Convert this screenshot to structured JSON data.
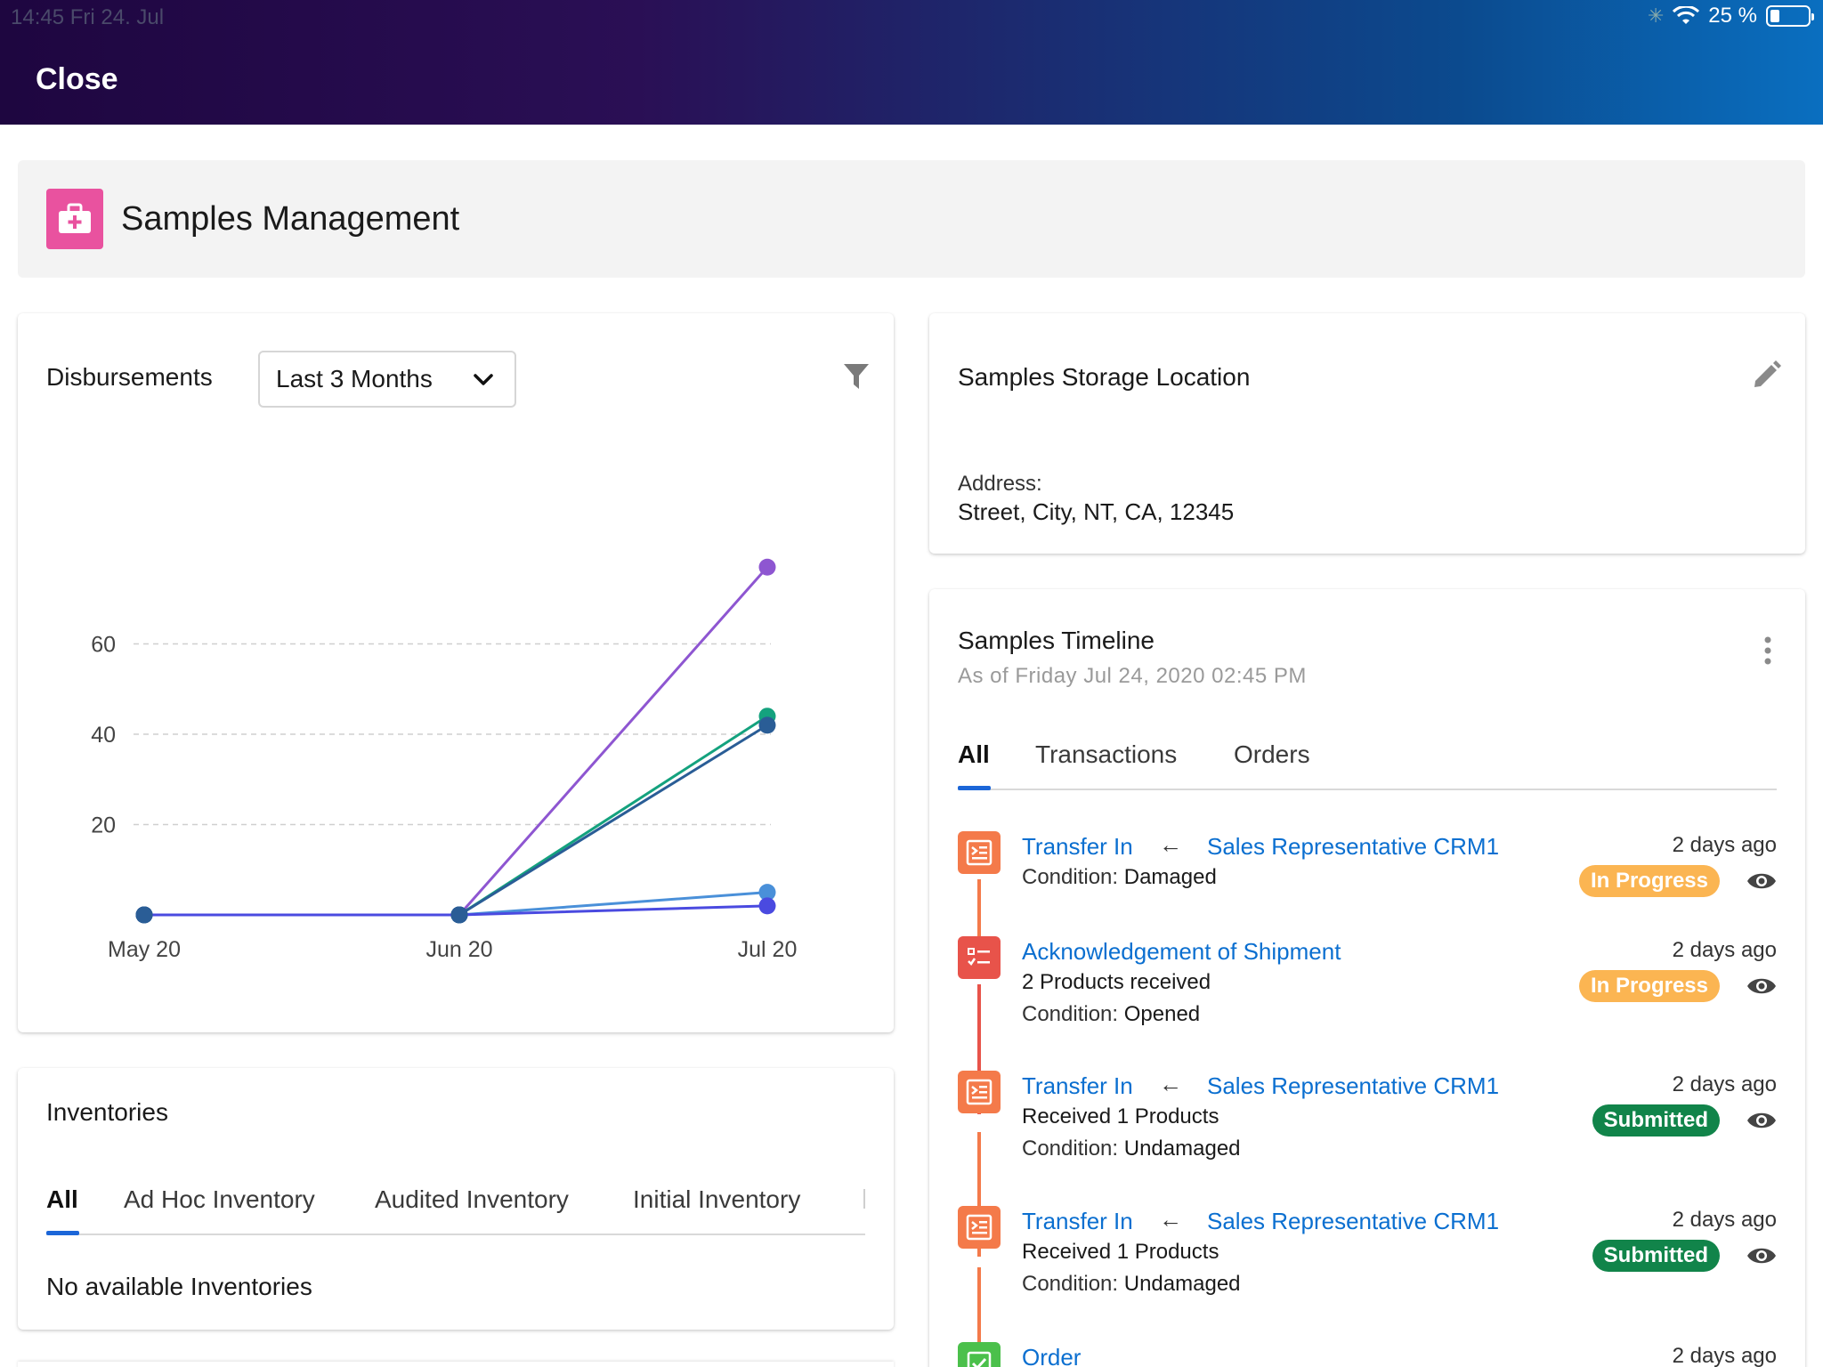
{
  "status": {
    "time": "14:45   Fri 24. Jul",
    "battery": "25 %"
  },
  "nav": {
    "close_label": "Close"
  },
  "header": {
    "title": "Samples Management",
    "icon": "medical-bag-icon",
    "icon_color": "#e9529f"
  },
  "disbursements": {
    "title": "Disbursements",
    "range_selected": "Last 3 Months",
    "chart_data": {
      "type": "line",
      "categories": [
        "May 20",
        "Jun 20",
        "Jul 20"
      ],
      "yticks": [
        "20",
        "40",
        "60"
      ],
      "ylim": [
        0,
        80
      ],
      "grid": true,
      "series": [
        {
          "color": "#8e56d1",
          "values": [
            0,
            0,
            77
          ]
        },
        {
          "color": "#14a27e",
          "values": [
            0,
            0,
            44
          ]
        },
        {
          "color": "#2a5d96",
          "values": [
            0,
            0,
            42
          ]
        },
        {
          "color": "#4a90d9",
          "values": [
            0,
            0,
            5
          ]
        },
        {
          "color": "#4a4ae0",
          "values": [
            0,
            0,
            2
          ]
        }
      ]
    }
  },
  "storage": {
    "title": "Samples Storage Location",
    "address_label": "Address:",
    "address_value": "Street, City, NT, CA, 12345"
  },
  "timeline": {
    "title": "Samples Timeline",
    "subtitle": "As of Friday Jul 24, 2020 02:45 PM",
    "tabs": [
      {
        "label": "All",
        "active": true
      },
      {
        "label": "Transactions",
        "active": false
      },
      {
        "label": "Orders",
        "active": false
      }
    ],
    "items": [
      {
        "icon": "transfer-icon",
        "color": "#f47a4a",
        "title": "Transfer In",
        "arrow": "←",
        "source": "Sales Representative CRM1",
        "lines": [
          {
            "label": "Condition:",
            "value": "Damaged"
          }
        ],
        "time": "2 days ago",
        "status": "In Progress",
        "status_color": "#fbb552"
      },
      {
        "icon": "checklist-icon",
        "color": "#e8534a",
        "title": "Acknowledgement of Shipment",
        "lines": [
          {
            "label": "",
            "value": "2 Products received"
          },
          {
            "label": "Condition:",
            "value": "Opened"
          }
        ],
        "time": "2 days ago",
        "status": "In Progress",
        "status_color": "#fbb552"
      },
      {
        "icon": "transfer-icon",
        "color": "#f47a4a",
        "title": "Transfer In",
        "arrow": "←",
        "source": "Sales Representative CRM1",
        "lines": [
          {
            "label": "",
            "value": "Received 1 Products"
          },
          {
            "label": "Condition:",
            "value": "Undamaged"
          }
        ],
        "time": "2 days ago",
        "status": "Submitted",
        "status_color": "#11844a"
      },
      {
        "icon": "transfer-icon",
        "color": "#f47a4a",
        "title": "Transfer In",
        "arrow": "←",
        "source": "Sales Representative CRM1",
        "lines": [
          {
            "label": "",
            "value": "Received 1 Products"
          },
          {
            "label": "Condition:",
            "value": "Undamaged"
          }
        ],
        "time": "2 days ago",
        "status": "Submitted",
        "status_color": "#11844a"
      },
      {
        "icon": "order-check-icon",
        "color": "#4bc04b",
        "title": "Order",
        "time": "2 days ago"
      }
    ]
  },
  "inventories": {
    "title": "Inventories",
    "tabs": [
      {
        "label": "All",
        "active": true
      },
      {
        "label": "Ad Hoc Inventory",
        "active": false
      },
      {
        "label": "Audited Inventory",
        "active": false
      },
      {
        "label": "Initial Inventory",
        "active": false
      }
    ],
    "empty_text": "No available Inventories"
  }
}
